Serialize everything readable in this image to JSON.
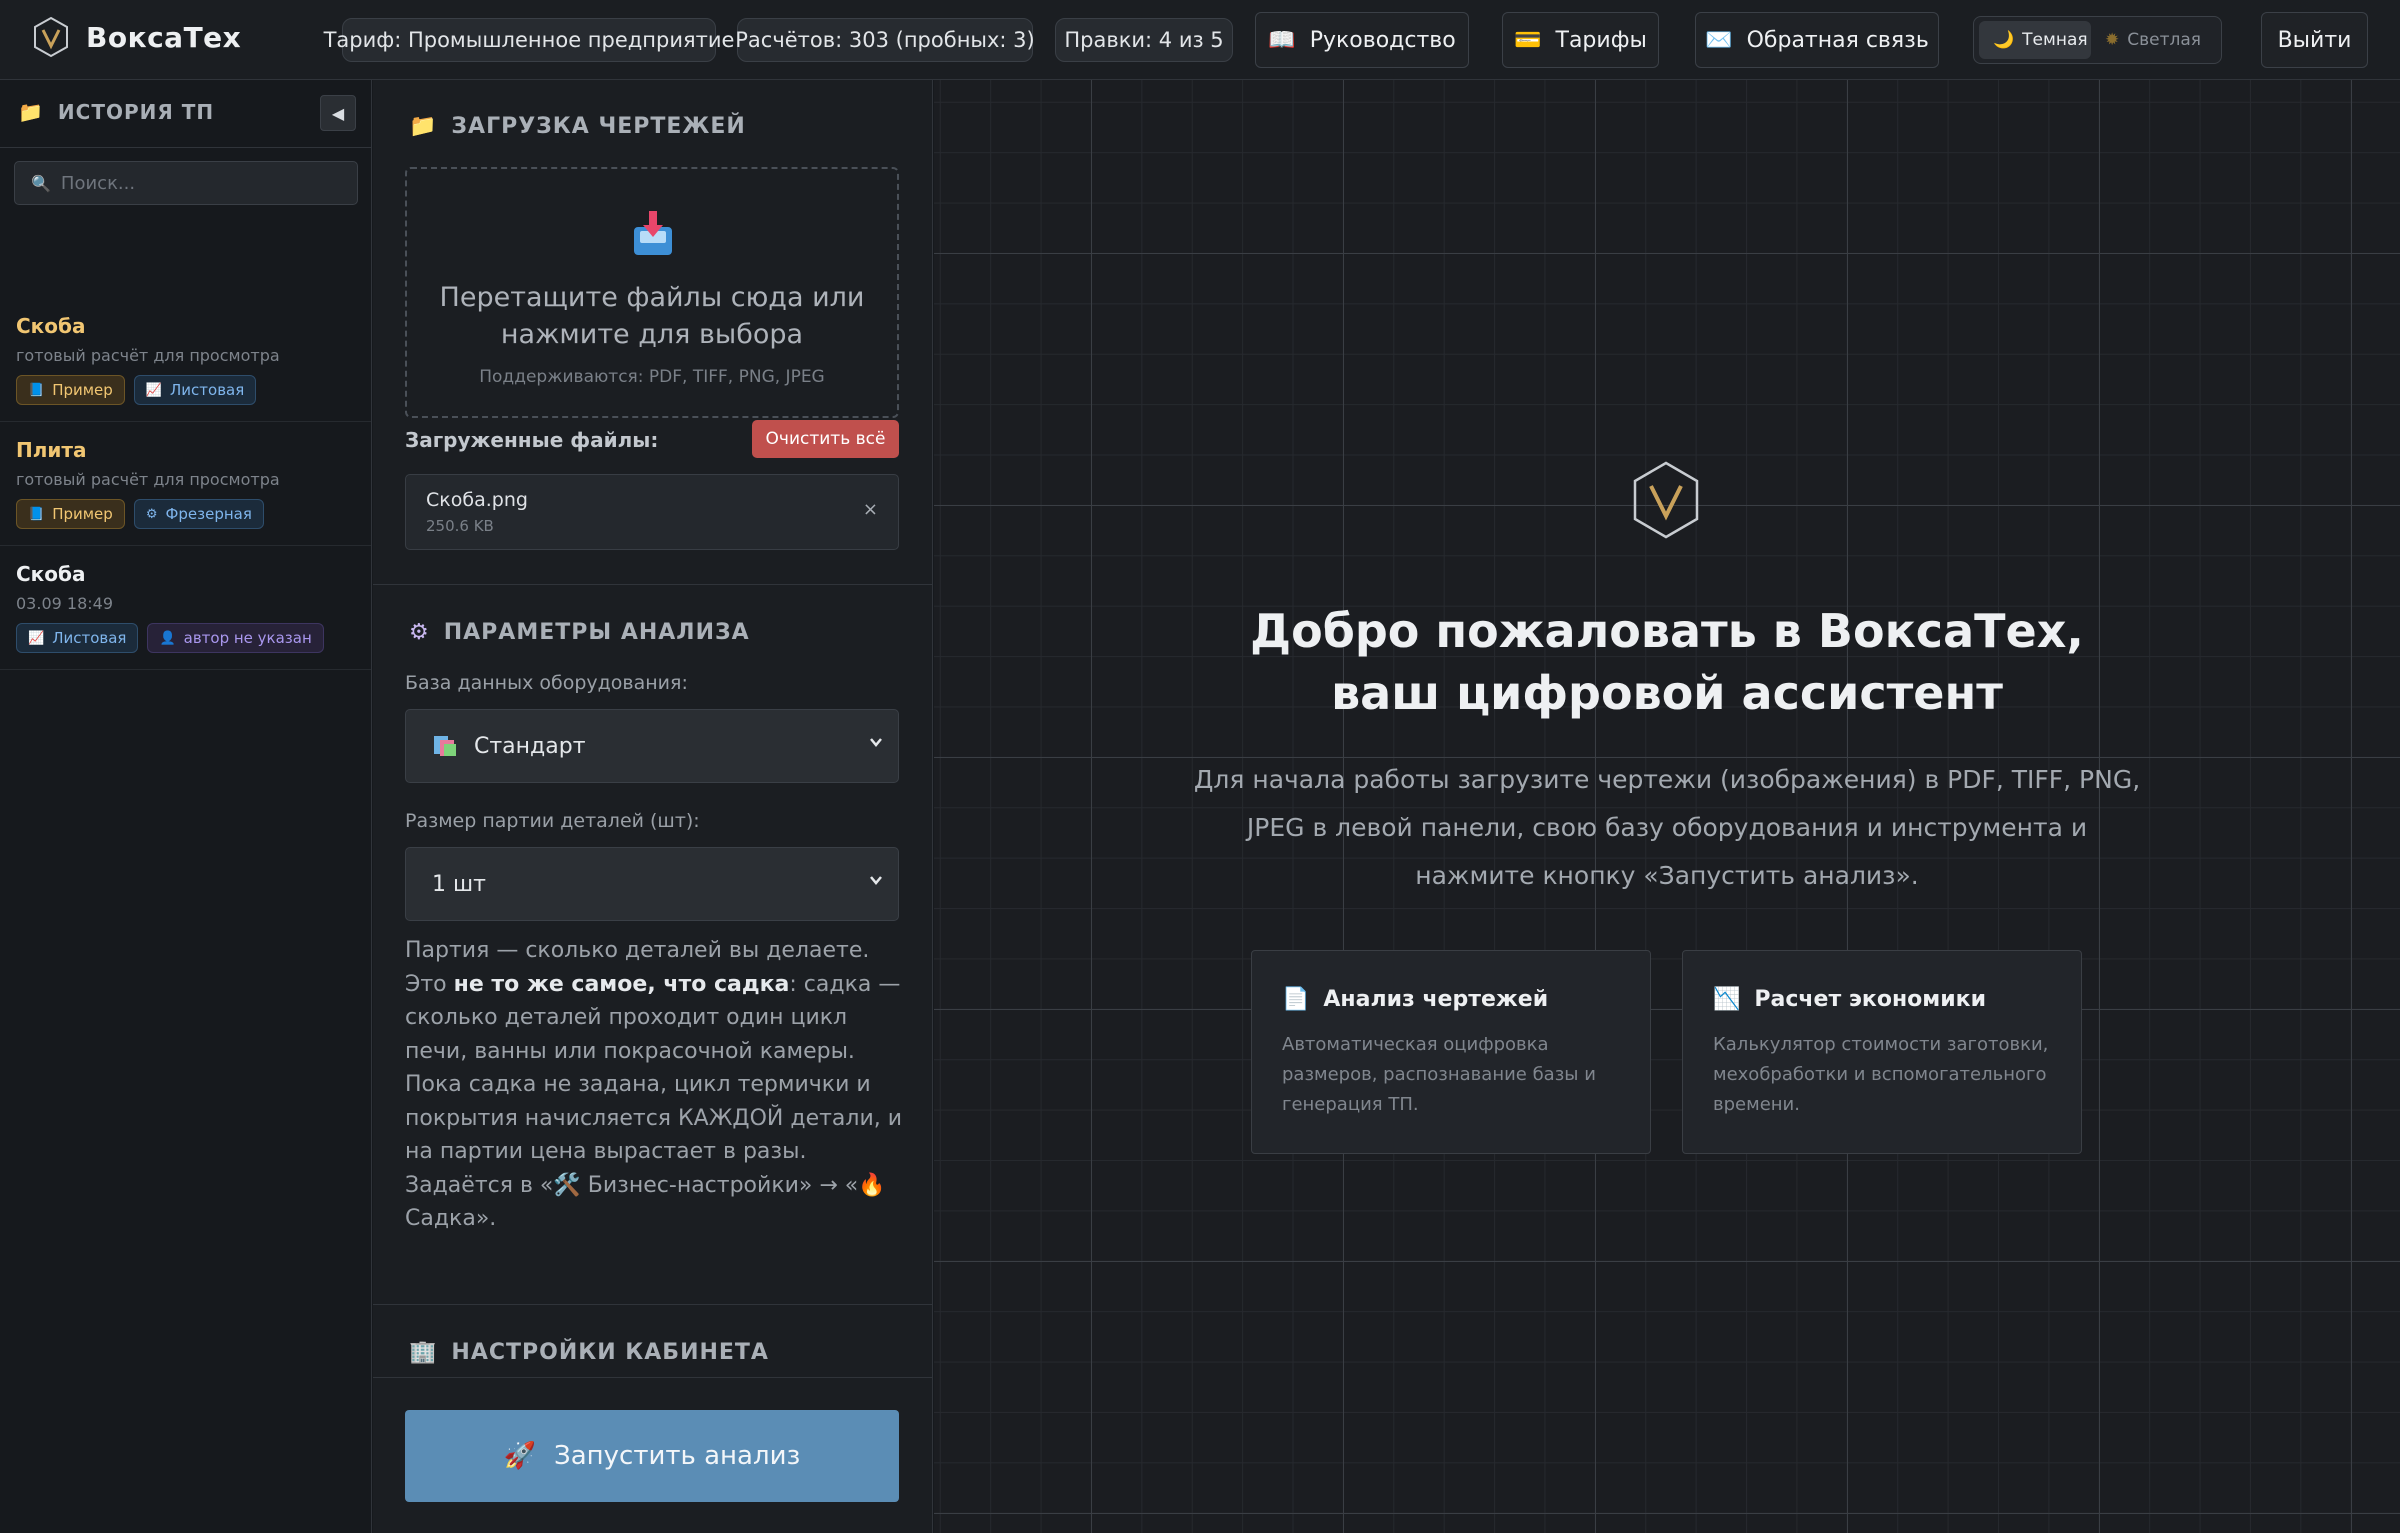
{
  "brand": {
    "name": "ВоксаТех"
  },
  "topbar": {
    "plan": "Тариф: Промышленное предприятие",
    "calcs": "Расчётов: 303 (пробных: 3)",
    "edits": "Правки: 4 из 5",
    "guide": "Руководство",
    "tariffs": "Тарифы",
    "feedback": "Обратная связь",
    "theme_dark": "Темная",
    "theme_light": "Светлая",
    "logout": "Выйти"
  },
  "sidebar": {
    "title": "ИСТОРИЯ ТП",
    "collapse": "◀",
    "search_placeholder": "Поиск...",
    "items": [
      {
        "title": "Скоба",
        "subtitle": "готовый расчёт для просмотра",
        "title_color": "#f1c672",
        "tags": [
          {
            "label": "Пример",
            "style": "example",
            "icon": "book-icon"
          },
          {
            "label": "Листовая",
            "style": "blue",
            "icon": "chart-icon"
          }
        ]
      },
      {
        "title": "Плита",
        "subtitle": "готовый расчёт для просмотра",
        "title_color": "#f1c672",
        "tags": [
          {
            "label": "Пример",
            "style": "example",
            "icon": "book-icon"
          },
          {
            "label": "Фрезерная",
            "style": "blue",
            "icon": "mill-icon"
          }
        ]
      },
      {
        "title": "Скоба",
        "subtitle": "03.09 18:49",
        "title_color": "#eef0f2",
        "tags": [
          {
            "label": "Листовая",
            "style": "blue",
            "icon": "chart-icon"
          },
          {
            "label": "автор не указан",
            "style": "purple",
            "icon": "user-icon"
          }
        ]
      }
    ]
  },
  "upload": {
    "title": "ЗАГРУЗКА ЧЕРТЕЖЕЙ",
    "drop_text": "Перетащите файлы сюда или нажмите для выбора",
    "hint": "Поддерживаются: PDF, TIFF, PNG, JPEG",
    "files_label": "Загруженные файлы:",
    "clear_all": "Очистить всё",
    "files": [
      {
        "name": "Скоба.png",
        "size": "250.6 KB",
        "remove": "×"
      }
    ]
  },
  "params": {
    "title": "ПАРАМЕТРЫ АНАЛИЗА",
    "db_label": "База данных оборудования:",
    "db_value": "Стандарт",
    "batch_label": "Размер партии деталей (шт):",
    "batch_value": "1 шт",
    "note_1": "Партия — сколько деталей вы делаете. Это ",
    "note_bold": "не то же самое, что садка",
    "note_2": ": садка — сколько деталей проходит один цикл печи, ванны или покрасочной камеры. Пока садка не задана, цикл термички и покрытия начисляется КАЖДОЙ детали, и на партии цена вырастает в разы. Задаётся в «",
    "note_link1": " Бизнес-настройки» → «",
    "note_link2": " Садка»."
  },
  "cabinet": {
    "title": "НАСТРОЙКИ КАБИНЕТА"
  },
  "run": {
    "label": "Запустить анализ"
  },
  "main": {
    "title": "Добро пожаловать в ВоксаТех, ваш цифровой ассистент",
    "description": "Для начала работы загрузите чертежи (изображения) в PDF, TIFF, PNG, JPEG в левой панели, свою базу оборудования и инструмента и нажмите кнопку «Запустить анализ».",
    "features": [
      {
        "title": "Анализ чертежей",
        "desc": "Автоматическая оцифровка размеров, распознавание базы и генерация ТП.",
        "icon": "document-icon"
      },
      {
        "title": "Расчет экономики",
        "desc": "Калькулятор стоимости заготовки, мехобработки и вспомогательного времени.",
        "icon": "chart-down-icon"
      }
    ]
  },
  "colors": {
    "accent": "#5b8db5",
    "brand_gold": "#c9a15a",
    "danger": "#c0504d",
    "example_tag": "#f1c672",
    "blue_tag": "#7fb5ec"
  }
}
